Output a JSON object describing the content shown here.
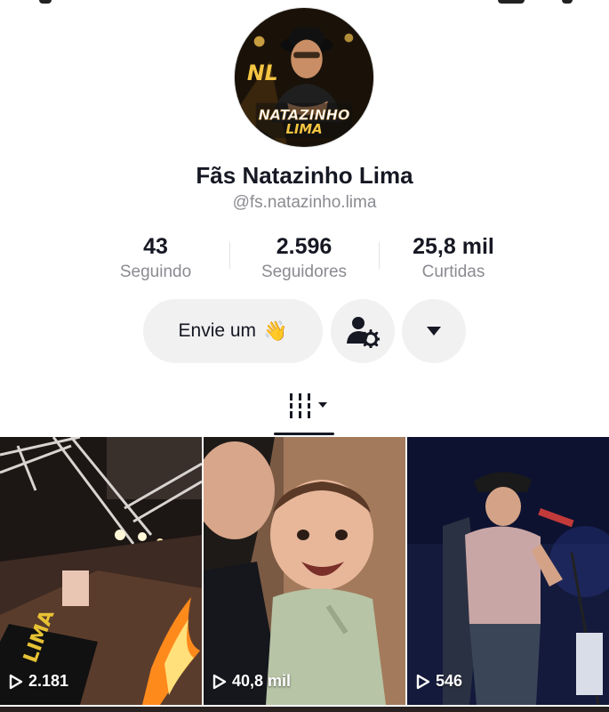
{
  "profile": {
    "display_name": "Fãs Natazinho Lima",
    "username": "@fs.natazinho.lima",
    "avatar_text": "NATAZINHO LIMA"
  },
  "stats": [
    {
      "value": "43",
      "label": "Seguindo"
    },
    {
      "value": "2.596",
      "label": "Seguidores"
    },
    {
      "value": "25,8 mil",
      "label": "Curtidas"
    }
  ],
  "actions": {
    "message_label": "Envie um",
    "message_emoji": "👋",
    "friends_icon": "person-gear-icon",
    "more_icon": "caret-down-icon"
  },
  "tabs": {
    "active_icon": "grid-bars-icon"
  },
  "videos": [
    {
      "views": "2.181",
      "subject": "concert stage"
    },
    {
      "views": "40,8 mil",
      "subject": "baby"
    },
    {
      "views": "546",
      "subject": "singer with guitar"
    }
  ],
  "colors": {
    "text": "#161823",
    "muted": "#8a8b91",
    "button_bg": "#f1f1f2"
  }
}
